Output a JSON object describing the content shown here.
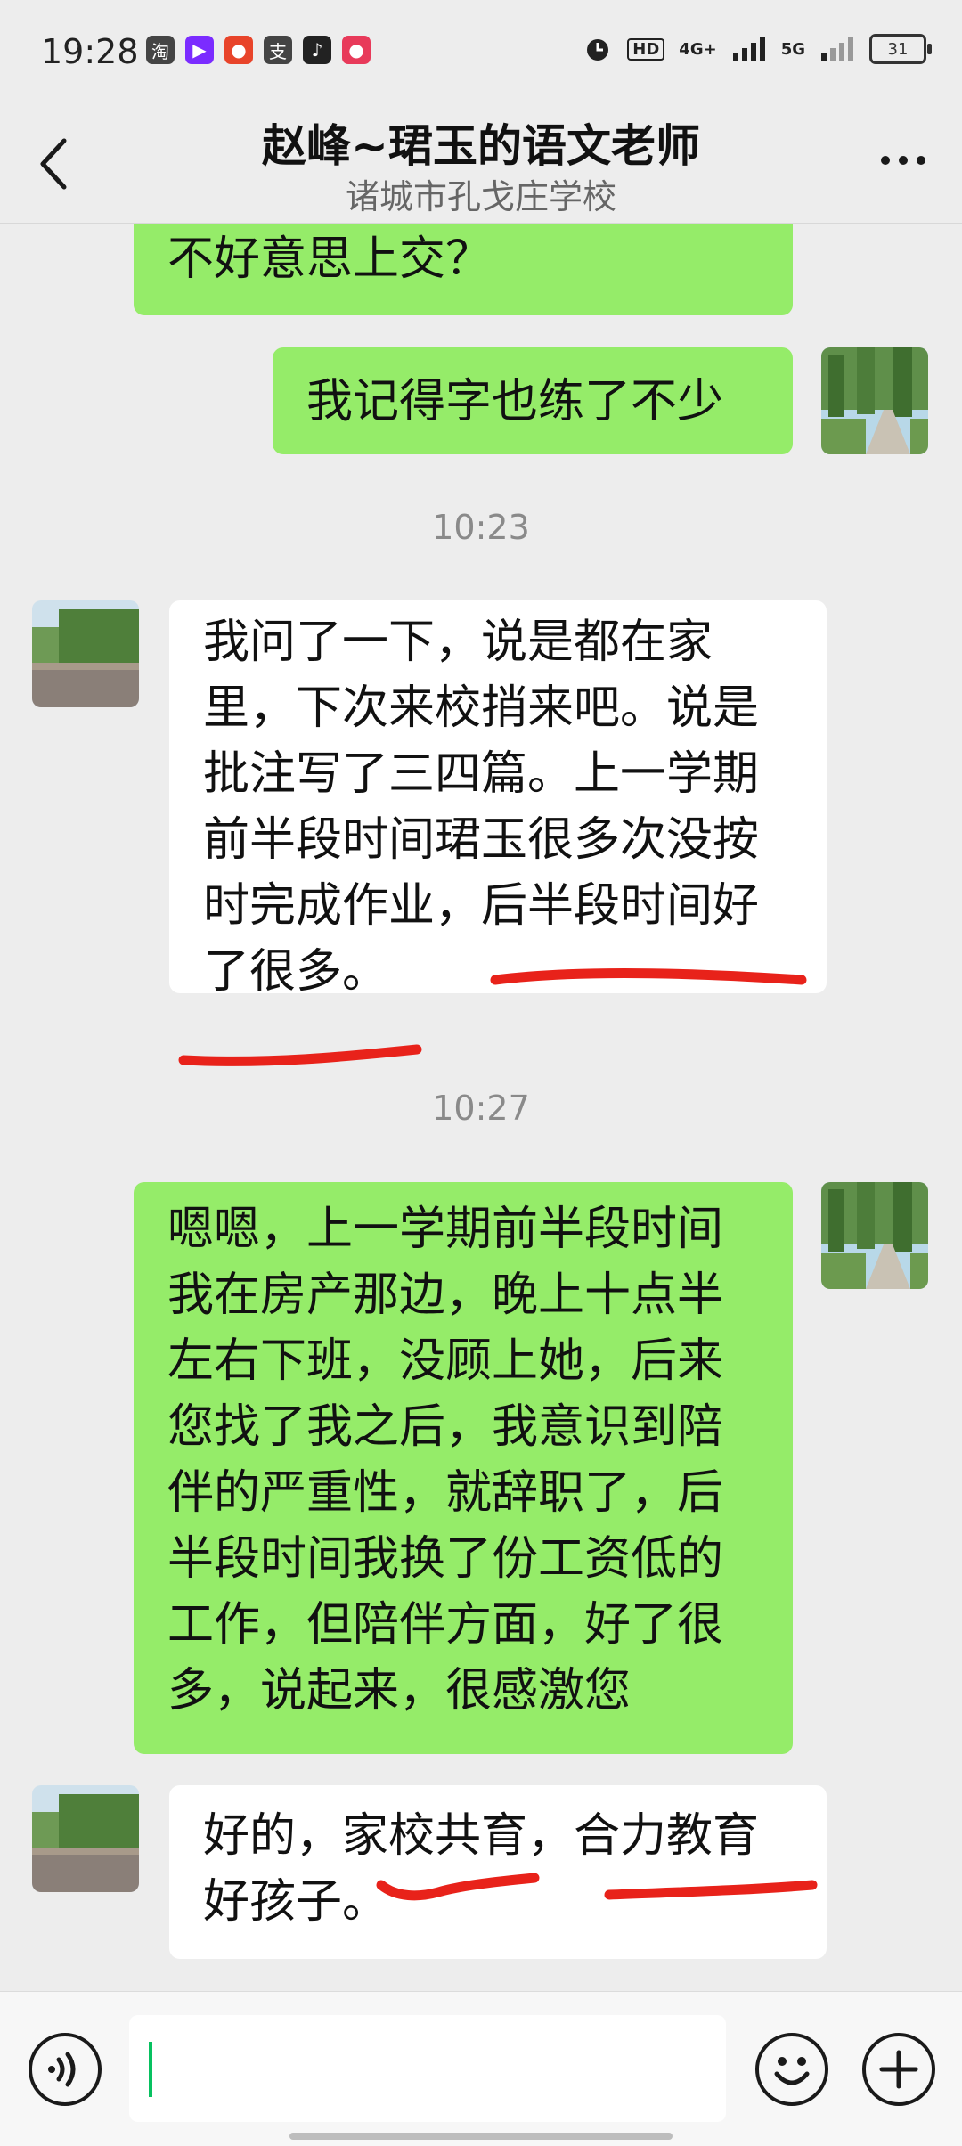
{
  "status_bar": {
    "time": "19:28",
    "apps": [
      "淘",
      "▶",
      "●",
      "支",
      "♪",
      "●"
    ],
    "network": "4G+",
    "network2": "5G",
    "hd": "HD",
    "battery": "31"
  },
  "header": {
    "title": "赵峰~珺玉的语文老师",
    "subtitle": "诸城市孔戈庄学校"
  },
  "messages": [
    {
      "side": "right",
      "text": "不好意思上交？"
    },
    {
      "side": "right",
      "text": "我记得字也练了不少"
    },
    {
      "timestamp": "10:23"
    },
    {
      "side": "left",
      "text": "我问了一下，说是都在家\n里，下次来校捎来吧。说是\n批注写了三四篇。上一学期\n前半段时间珺玉很多次没按\n时完成作业，后半段时间好\n了很多。"
    },
    {
      "timestamp": "10:27"
    },
    {
      "side": "right",
      "text": "嗯嗯，上一学期前半段时间\n我在房产那边，晚上十点半\n左右下班，没顾上她，后来\n您找了我之后，我意识到陪\n伴的严重性，就辞职了，后\n半段时间我换了份工资低的\n工作，但陪伴方面，好了很\n多，说起来，很感激您"
    },
    {
      "side": "left",
      "text": "好的，家校共育，合力教育\n好孩子。"
    }
  ],
  "colors": {
    "green_bubble": "#95ec69",
    "white_bubble": "#ffffff",
    "annotation_red": "#e8221a"
  }
}
